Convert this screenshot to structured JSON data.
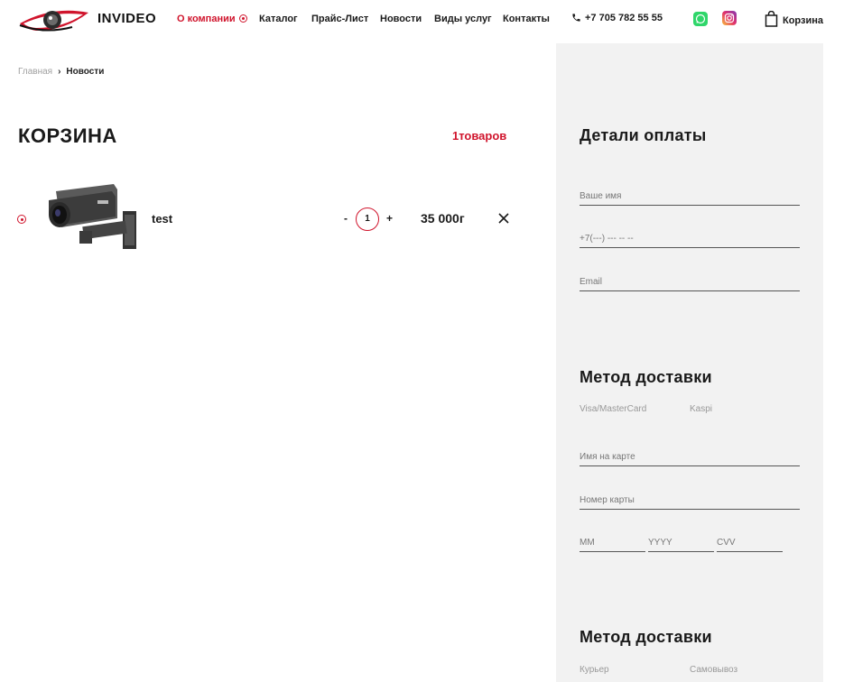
{
  "header": {
    "brand": "INVIDEO",
    "nav": [
      {
        "label": "О компании",
        "active": true
      },
      {
        "label": "Каталог"
      },
      {
        "label": "Прайс-Лист"
      },
      {
        "label": "Новости"
      },
      {
        "label": "Виды услуг"
      },
      {
        "label": "Контакты"
      }
    ],
    "phone": "+7 705 782 55 55",
    "cart_label": "Корзина"
  },
  "breadcrumb": {
    "home": "Главная",
    "separator": "›",
    "current": "Новости"
  },
  "cart": {
    "title": "КОРЗИНА",
    "count": "1товаров",
    "items": [
      {
        "name": "test",
        "qty_minus": "-",
        "quantity": "1",
        "qty_plus": "+",
        "price": "35 000г"
      }
    ]
  },
  "checkout": {
    "payment_title": "Детали оплаты",
    "fields": {
      "name": "Ваше имя",
      "phone": "+7(---) --- -- --",
      "email": "Email"
    },
    "delivery_method_title": "Метод доставки",
    "payment_options": [
      "Visa/MasterCard",
      "Kaspi"
    ],
    "card": {
      "holder": "Имя на карте",
      "number": "Номер карты",
      "month": "MM",
      "year": "YYYY",
      "cvv": "CVV"
    },
    "delivery_title": "Метод доставки",
    "delivery_options": [
      "Курьер",
      "Самовывоз"
    ]
  },
  "colors": {
    "accent": "#d0142c",
    "panel": "#f2f2f2"
  }
}
